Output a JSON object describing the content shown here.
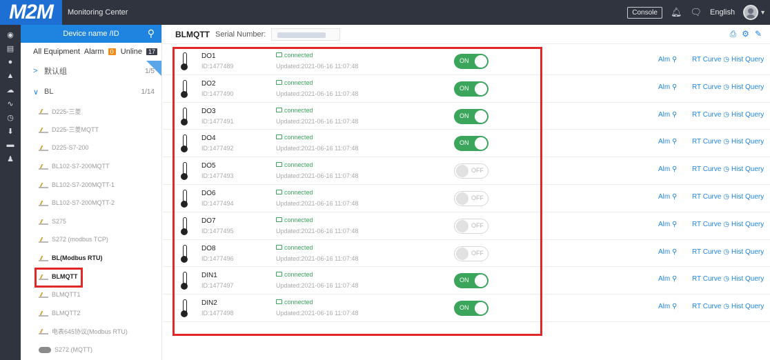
{
  "topbar": {
    "logo": "M2M",
    "title": "Monitoring Center",
    "console_label": "Console",
    "language": "English",
    "icons": [
      "bell-icon",
      "chat-icon"
    ]
  },
  "rail": {
    "icons": [
      "locate-icon",
      "device-icon",
      "map-pin-icon",
      "alarm-icon",
      "cloud-icon",
      "pulse-icon",
      "clock-icon",
      "download-icon",
      "screen-icon",
      "user-icon"
    ]
  },
  "tree": {
    "search_placeholder": "Device name /ID",
    "tabs": {
      "all": "All Equipment",
      "alarm": "Alarm",
      "alarm_count": "0",
      "unline": "Unline",
      "unline_count": "17"
    },
    "groups": [
      {
        "label": "默认组",
        "count": "1/5",
        "chevron": ">"
      },
      {
        "label": "BL",
        "count": "1/14",
        "chevron": "∨"
      }
    ],
    "devices": [
      {
        "label": "D225-三菱",
        "bold": false
      },
      {
        "label": "D225-三菱MQTT",
        "bold": false
      },
      {
        "label": "D225-S7-200",
        "bold": false
      },
      {
        "label": "BL102-S7-200MQTT",
        "bold": false
      },
      {
        "label": "BL102-S7-200MQTT-1",
        "bold": false
      },
      {
        "label": "BL102-S7-200MQTT-2",
        "bold": false
      },
      {
        "label": "S275",
        "bold": false
      },
      {
        "label": "S272 (modbus TCP)",
        "bold": false
      },
      {
        "label": "BL(Modbus RTU)",
        "bold": true
      },
      {
        "label": "BLMQTT",
        "bold": true
      },
      {
        "label": "BLMQTT1",
        "bold": false
      },
      {
        "label": "BLMQTT2",
        "bold": false
      },
      {
        "label": "电表645协议(Modbus RTU)",
        "bold": false
      },
      {
        "label": "S272 (MQTT)",
        "bold": false
      }
    ]
  },
  "main": {
    "title": "BLMQTT",
    "serial_label": "Serial Number:",
    "actions": {
      "alm": "Alm",
      "rt": "RT Curve",
      "hist": "Hist Query"
    },
    "rows": [
      {
        "name": "DO1",
        "id": "ID:1477489",
        "status": "connected",
        "updated": "Updated:2021-06-16 11:07:48",
        "state": "ON"
      },
      {
        "name": "DO2",
        "id": "ID:1477490",
        "status": "connected",
        "updated": "Updated:2021-06-16 11:07:48",
        "state": "ON"
      },
      {
        "name": "DO3",
        "id": "ID:1477491",
        "status": "connected",
        "updated": "Updated:2021-06-16 11:07:48",
        "state": "ON"
      },
      {
        "name": "DO4",
        "id": "ID:1477492",
        "status": "connected",
        "updated": "Updated:2021-06-16 11:07:48",
        "state": "ON"
      },
      {
        "name": "DO5",
        "id": "ID:1477493",
        "status": "connected",
        "updated": "Updated:2021-06-16 11:07:48",
        "state": "OFF"
      },
      {
        "name": "DO6",
        "id": "ID:1477494",
        "status": "connected",
        "updated": "Updated:2021-06-16 11:07:48",
        "state": "OFF"
      },
      {
        "name": "DO7",
        "id": "ID:1477495",
        "status": "connected",
        "updated": "Updated:2021-06-16 11:07:48",
        "state": "OFF"
      },
      {
        "name": "DO8",
        "id": "ID:1477496",
        "status": "connected",
        "updated": "Updated:2021-06-16 11:07:48",
        "state": "OFF"
      },
      {
        "name": "DIN1",
        "id": "ID:1477497",
        "status": "connected",
        "updated": "Updated:2021-06-16 11:07:48",
        "state": "ON"
      },
      {
        "name": "DIN2",
        "id": "ID:1477498",
        "status": "connected",
        "updated": "Updated:2021-06-16 11:07:48",
        "state": "ON"
      }
    ]
  },
  "colors": {
    "topbar": "#30343f",
    "accent": "#1e84e0",
    "on_green": "#3aa55b",
    "highlight_red": "#e02828",
    "alarm_orange": "#f08c1a"
  }
}
